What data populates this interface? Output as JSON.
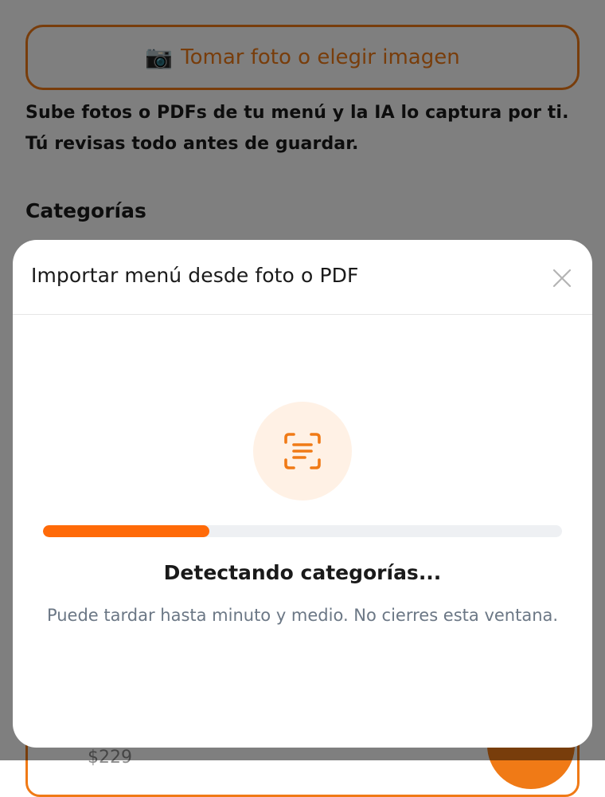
{
  "background": {
    "upload_button_label": "Tomar foto o elegir imagen",
    "upload_button_icon": "camera-icon",
    "upload_desc_line1": "Sube fotos o PDFs de tu menú y la IA lo captura por ti.",
    "upload_desc_line2": "Tú revisas todo antes de guardar.",
    "section_title": "Categorías",
    "partial_price": "$229"
  },
  "modal": {
    "title": "Importar menú desde foto o PDF",
    "close_icon": "close-icon",
    "scan_icon": "scan-text-icon",
    "progress_percent": 32,
    "status_title": "Detectando categorías...",
    "status_desc": "Puede tardar hasta minuto y medio. No cierres esta ventana."
  },
  "colors": {
    "accent": "#f07a16",
    "progress": "#ff6a08",
    "progress_track": "#eef0f3",
    "icon_bg": "#fff1e5",
    "muted_text": "#6b7785"
  }
}
